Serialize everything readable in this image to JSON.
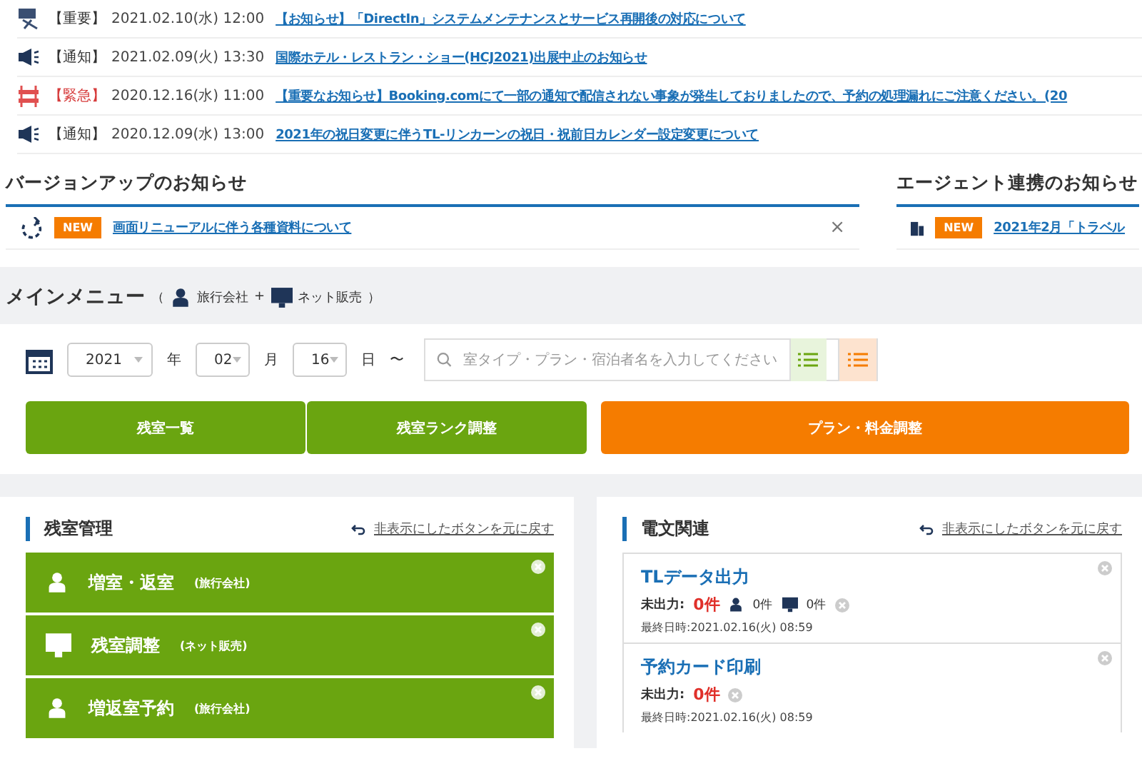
{
  "notices": [
    {
      "kind": "important",
      "tag": "【重要】",
      "date": "2021.02.10(水) 12:00",
      "title": "【お知らせ】「DirectIn」システムメンテナンスとサービス再開後の対応について"
    },
    {
      "kind": "notice",
      "tag": "【通知】",
      "date": "2021.02.09(火) 13:30",
      "title": "国際ホテル・レストラン・ショー(HCJ2021)出展中止のお知らせ"
    },
    {
      "kind": "urgent",
      "tag": "【緊急】",
      "date": "2020.12.16(水) 11:00",
      "title": "【重要なお知らせ】Booking.comにて一部の通知で配信されない事象が発生しておりましたので、予約の処理漏れにご注意ください。(20"
    },
    {
      "kind": "notice",
      "tag": "【通知】",
      "date": "2020.12.09(水) 13:00",
      "title": "2021年の祝日変更に伴うTL-リンカーンの祝日・祝前日カレンダー設定変更について"
    }
  ],
  "version_panel": {
    "title": "バージョンアップのお知らせ",
    "items": [
      {
        "badge": "NEW",
        "text": "画面リニューアルに伴う各種資料について",
        "close": "×"
      }
    ]
  },
  "agent_panel": {
    "title": "エージェント連携のお知らせ",
    "items": [
      {
        "badge": "NEW",
        "text": "2021年2月「トラベル"
      }
    ]
  },
  "main_menu": {
    "title": "メインメニュー",
    "open": "（",
    "agent": "旅行会社",
    "plus": "+",
    "net": "ネット販売",
    "close": "）"
  },
  "date_filter": {
    "year": "2021",
    "year_unit": "年",
    "month": "02",
    "month_unit": "月",
    "day": "16",
    "day_unit": "日",
    "tilde": "〜",
    "search_placeholder": "室タイプ・プラン・宿泊者名を入力してください"
  },
  "menu_buttons": [
    {
      "label": "残室一覧",
      "kind": "green"
    },
    {
      "label": "残室ランク調整",
      "kind": "green"
    },
    {
      "label": "プラン・料金調整",
      "kind": "orange"
    }
  ],
  "room_management": {
    "title": "残室管理",
    "restore_link": "非表示にしたボタンを元に戻す",
    "tiles": [
      {
        "kind": "agent",
        "label": "増室・返室",
        "sub": "(旅行会社)"
      },
      {
        "kind": "net",
        "label": "残室調整",
        "sub": "(ネット販売)"
      },
      {
        "kind": "agent",
        "label": "増返室予約",
        "sub": "(旅行会社)"
      }
    ]
  },
  "telegram": {
    "title": "電文関連",
    "restore_link": "非表示にしたボタンを元に戻す",
    "items": [
      {
        "title": "TLデータ出力",
        "pending_label": "未出力:",
        "pending": "0件",
        "agent_count": "0件",
        "net_count": "0件",
        "last": "最終日時:2021.02.16(火) 08:59"
      },
      {
        "title": "予約カード印刷",
        "pending_label": "未出力:",
        "pending": "0件",
        "last": "最終日時:2021.02.16(火) 08:59"
      }
    ]
  }
}
